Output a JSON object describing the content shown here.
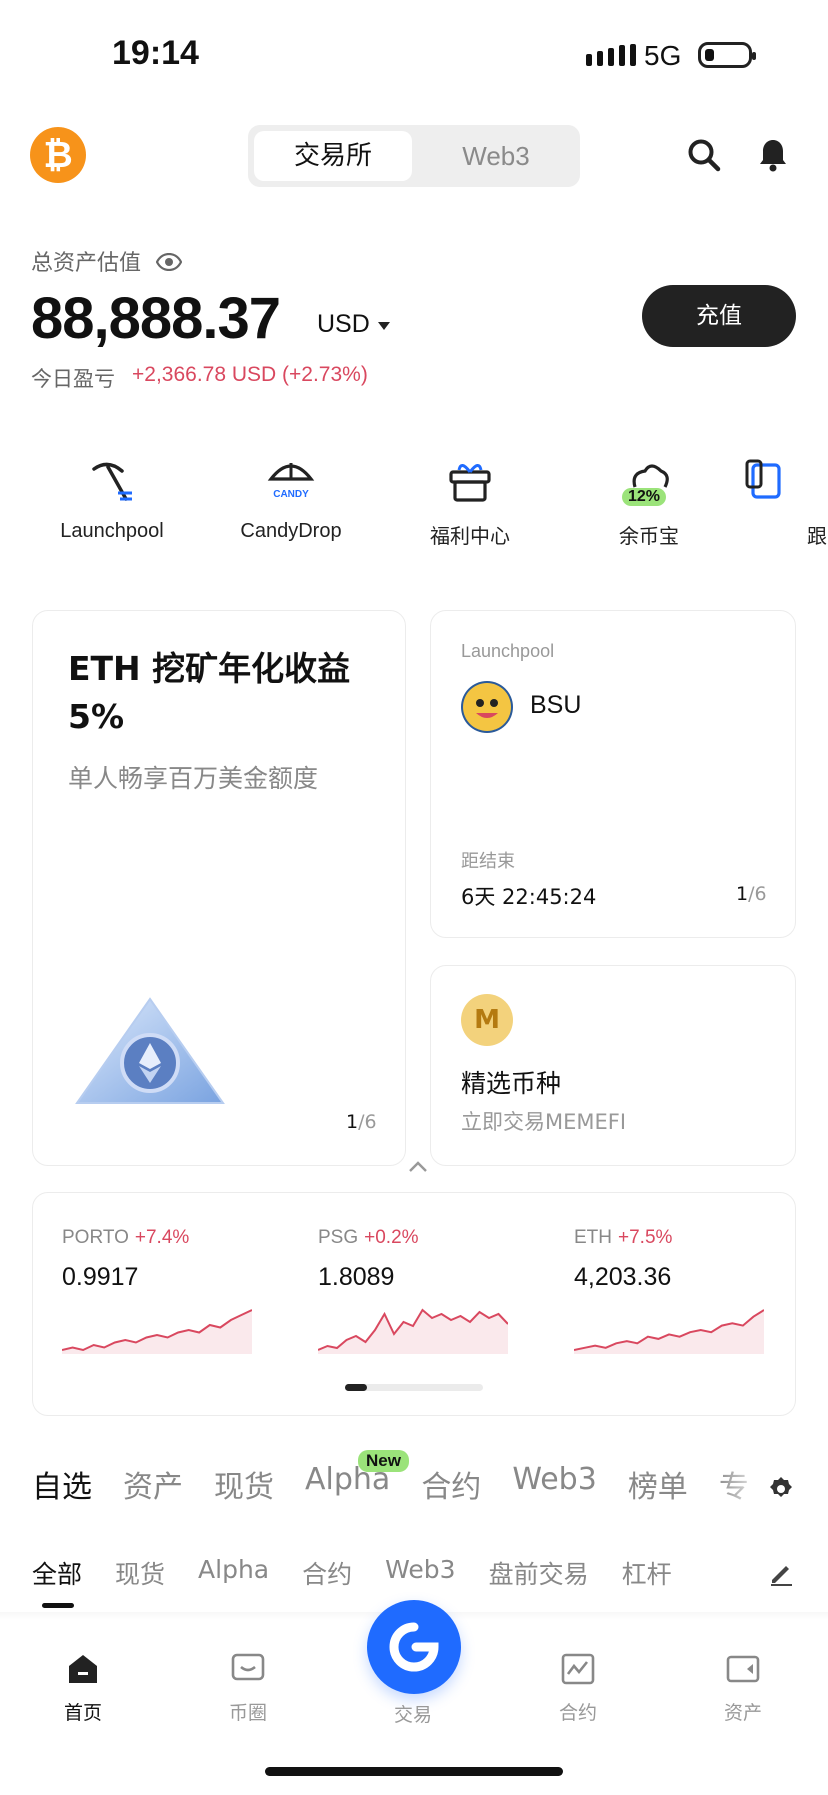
{
  "status_bar": {
    "time": "19:14",
    "network": "5G"
  },
  "header": {
    "tabs": [
      {
        "label": "交易所",
        "active": true
      },
      {
        "label": "Web3",
        "active": false
      }
    ],
    "icons": [
      "search-icon",
      "bell-icon"
    ]
  },
  "balance": {
    "label": "总资产估值",
    "amount": "88,888.37",
    "currency": "USD",
    "pnl_label": "今日盈亏",
    "pnl_value": "+2,366.78 USD  (+2.73%)",
    "deposit_label": "充值"
  },
  "quick_actions": [
    {
      "label": "Launchpool",
      "icon": "pickaxe-icon"
    },
    {
      "label": "CandyDrop",
      "icon": "parachute-icon",
      "badge": "CANDY"
    },
    {
      "label": "福利中心",
      "icon": "gift-icon"
    },
    {
      "label": "余币宝",
      "icon": "cloud-coin-icon",
      "badge": "12%"
    },
    {
      "label": "跟",
      "icon": "copy-trade-icon"
    }
  ],
  "promo_card": {
    "title": "ETH 挖矿年化收益 5%",
    "subtitle": "单人畅享百万美金额度",
    "page": "1",
    "total": "/6"
  },
  "launchpool_card": {
    "label": "Launchpool",
    "token": "BSU",
    "ends_label": "距结束",
    "countdown": "6天 22:45:24",
    "page": "1",
    "total": "/6"
  },
  "featured_card": {
    "title": "精选币种",
    "subtitle": "立即交易MEMEFI",
    "coin_letter": "M"
  },
  "market_strip": [
    {
      "name": "PORTO",
      "change": "+7.4%",
      "price": "0.9917",
      "spark": [
        6,
        7,
        6,
        8,
        7,
        9,
        10,
        9,
        11,
        12,
        11,
        13,
        14,
        13,
        16,
        15,
        18,
        20,
        22
      ]
    },
    {
      "name": "PSG",
      "change": "+0.2%",
      "price": "1.8089",
      "spark": [
        4,
        6,
        5,
        9,
        11,
        8,
        14,
        22,
        12,
        18,
        16,
        24,
        20,
        22,
        19,
        21,
        18,
        23,
        20,
        22,
        17
      ]
    },
    {
      "name": "ETH",
      "change": "+7.5%",
      "price": "4,203.36",
      "spark": [
        6,
        7,
        8,
        7,
        9,
        10,
        9,
        12,
        11,
        13,
        12,
        14,
        15,
        14,
        17,
        18,
        17,
        21,
        24
      ]
    }
  ],
  "primary_tabs": [
    {
      "label": "自选",
      "active": true
    },
    {
      "label": "资产",
      "active": false
    },
    {
      "label": "现货",
      "active": false
    },
    {
      "label": "Alpha",
      "active": false,
      "badge": "New"
    },
    {
      "label": "合约",
      "active": false
    },
    {
      "label": "Web3",
      "active": false
    },
    {
      "label": "榜单",
      "active": false
    },
    {
      "label": "专",
      "active": false
    }
  ],
  "secondary_tabs": [
    {
      "label": "全部",
      "active": true
    },
    {
      "label": "现货",
      "active": false
    },
    {
      "label": "Alpha",
      "active": false
    },
    {
      "label": "合约",
      "active": false
    },
    {
      "label": "Web3",
      "active": false
    },
    {
      "label": "盘前交易",
      "active": false
    },
    {
      "label": "杠杆",
      "active": false
    }
  ],
  "bottom_nav": [
    {
      "label": "首页",
      "icon": "home-icon",
      "active": true
    },
    {
      "label": "币圈",
      "icon": "chat-icon",
      "active": false
    },
    {
      "label": "交易",
      "icon": "trade-icon",
      "active": false
    },
    {
      "label": "合约",
      "icon": "futures-icon",
      "active": false
    },
    {
      "label": "资产",
      "icon": "wallet-icon",
      "active": false
    }
  ],
  "colors": {
    "accent": "#1f6bff",
    "up": "#d9485f",
    "dark": "#222222",
    "new_badge": "#9be37a"
  }
}
